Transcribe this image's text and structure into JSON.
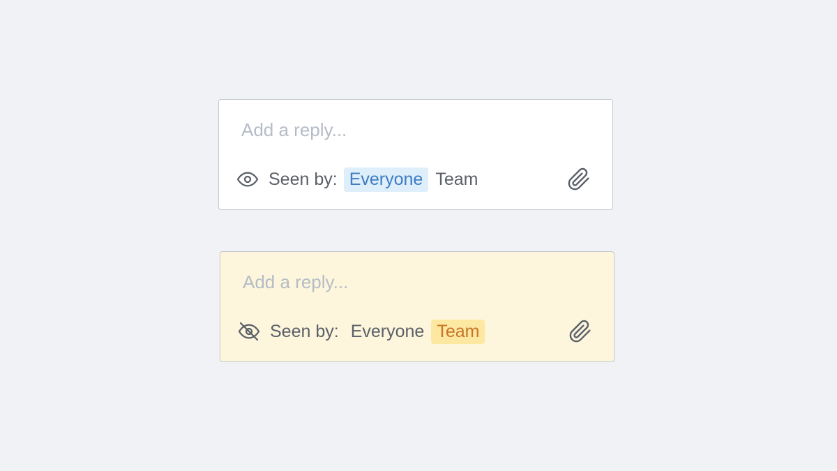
{
  "composers": [
    {
      "placeholder": "Add a reply...",
      "visibility_icon": "eye-icon",
      "seen_by_label": "Seen by:",
      "options": [
        "Everyone",
        "Team"
      ],
      "selected": "Everyone",
      "background_color": "#ffffff",
      "selected_color": "#3d7dc2",
      "selected_bg": "#deeefa",
      "attach_icon": "paperclip-icon"
    },
    {
      "placeholder": "Add a reply...",
      "visibility_icon": "eye-off-icon",
      "seen_by_label": "Seen by:",
      "options": [
        "Everyone",
        "Team"
      ],
      "selected": "Team",
      "background_color": "#fdf6dd",
      "selected_color": "#c7752a",
      "selected_bg": "#fce8a0",
      "attach_icon": "paperclip-icon"
    }
  ]
}
